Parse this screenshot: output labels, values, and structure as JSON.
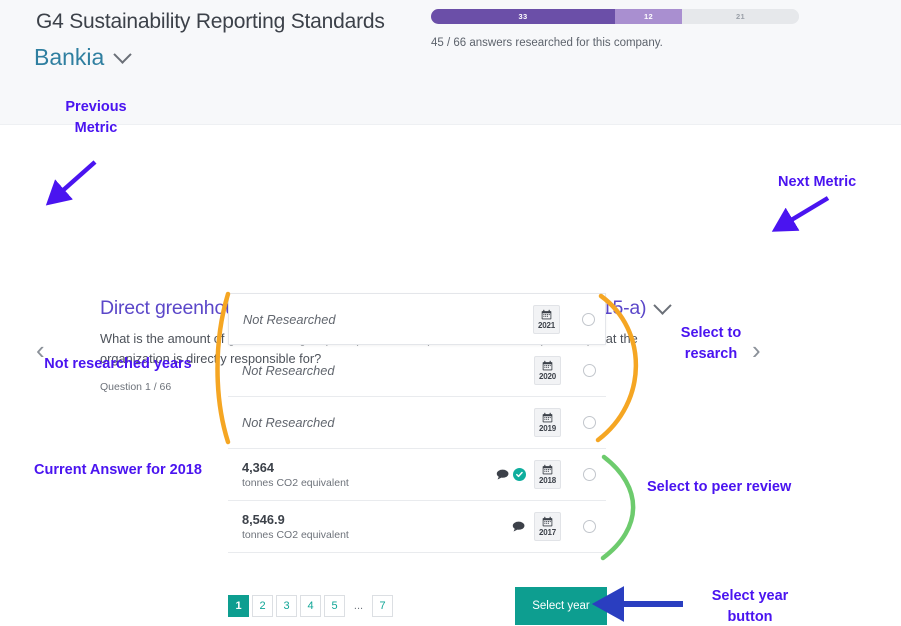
{
  "header": {
    "cut_off_line": "",
    "app_title": "G4 Sustainability Reporting Standards",
    "company": "Bankia",
    "company_chevron_icon": "chevron-down-icon",
    "progress": {
      "segments": [
        {
          "label": "33",
          "value": 33,
          "color": "#6b4fa8",
          "name": "researched"
        },
        {
          "label": "12",
          "value": 12,
          "color": "#a98fd0",
          "name": "peer-reviewed"
        },
        {
          "label": "21",
          "value": 21,
          "color": "#e6e8eb",
          "name": "remaining"
        }
      ],
      "caption": "45 / 66 answers researched for this company."
    }
  },
  "metric": {
    "prev_icon": "‹",
    "next_icon": "›",
    "title": "Direct greenhouse gas (GHG) emissions (Scope 1) (G4-EN15-a)",
    "title_chevron_icon": "chevron-down-icon",
    "description": "What is the amount of greenhouse gas (GHG) emissions (in tonnes of CO2 equivalent) that the organization is directly responsible for?",
    "question_count": "Question 1 / 66"
  },
  "answers": {
    "rows": [
      {
        "value": "Not Researched",
        "unit": "",
        "year": "2021",
        "empty": true,
        "has_comment": false,
        "has_check": false,
        "radio_selected": false
      },
      {
        "value": "Not Researched",
        "unit": "",
        "year": "2020",
        "empty": true,
        "has_comment": false,
        "has_check": false,
        "radio_selected": false
      },
      {
        "value": "Not Researched",
        "unit": "",
        "year": "2019",
        "empty": true,
        "has_comment": false,
        "has_check": false,
        "radio_selected": false
      },
      {
        "value": "4,364",
        "unit": "tonnes CO2 equivalent",
        "year": "2018",
        "empty": false,
        "has_comment": true,
        "has_check": true,
        "radio_selected": false
      },
      {
        "value": "8,546.9",
        "unit": "tonnes CO2 equivalent",
        "year": "2017",
        "empty": false,
        "has_comment": true,
        "has_check": false,
        "radio_selected": false
      }
    ],
    "calendar_icon": "calendar-icon",
    "comment_icon": "comment-bubble-icon",
    "check_icon": "check-circle-icon",
    "radio_icon": "radio-button-icon"
  },
  "footer": {
    "pagination": [
      {
        "label": "1",
        "active": true
      },
      {
        "label": "2",
        "active": false
      },
      {
        "label": "3",
        "active": false
      },
      {
        "label": "4",
        "active": false
      },
      {
        "label": "5",
        "active": false
      },
      {
        "label": "...",
        "active": false,
        "dots": true
      },
      {
        "label": "7",
        "active": false
      }
    ],
    "select_year_label": "Select year"
  },
  "annotations": {
    "previous_metric": "Previous\nMetric",
    "next_metric": "Next Metric",
    "not_researched_years": "Not researched years",
    "current_answer": "Current Answer for 2018",
    "select_to_research": "Select to\nresarch",
    "select_to_peer_review": "Select to peer review",
    "select_year_button": "Select year\nbutton"
  },
  "colors": {
    "annotation_purple": "#4a14f0",
    "annotation_blue_arrow": "#2a3ec0",
    "brace_orange": "#f5a623",
    "brace_green": "#6dcb6d",
    "teal_accent": "#0d9e90",
    "metric_purple": "#5b47c9",
    "company_teal": "#2f7fa0",
    "header_bg": "#f7f8fa"
  }
}
